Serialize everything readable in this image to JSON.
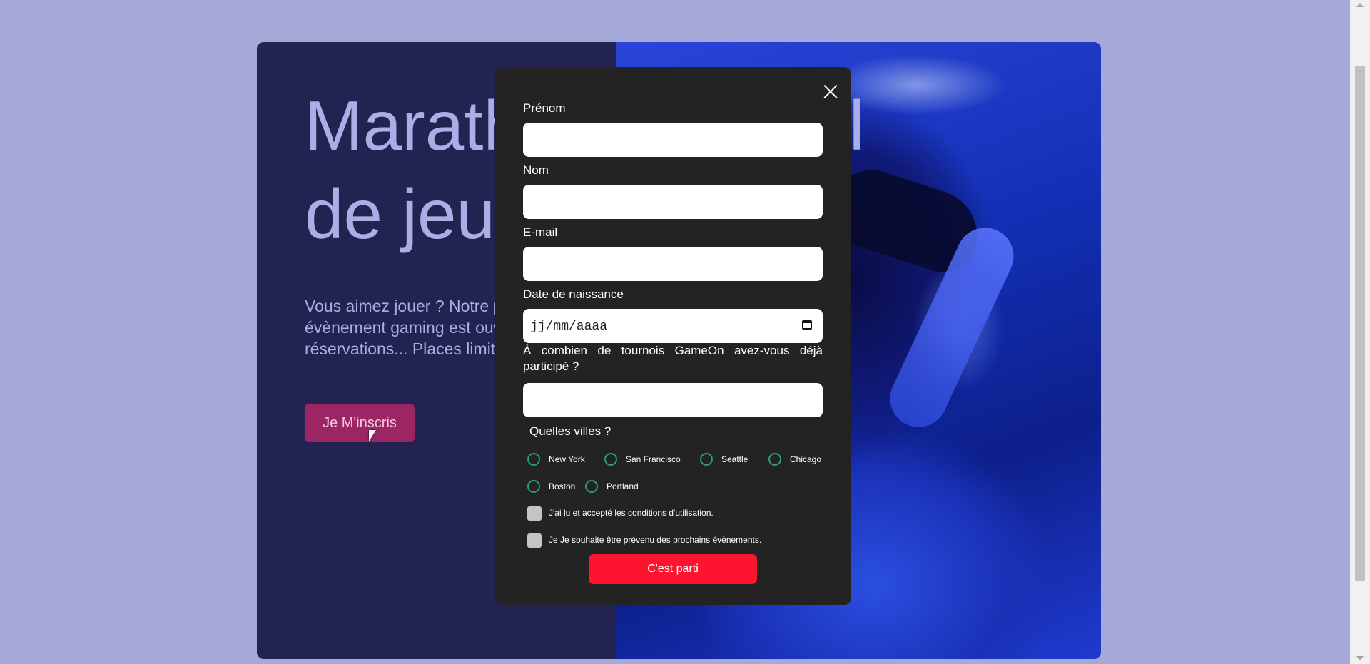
{
  "hero": {
    "title_line1": "Marathon national",
    "title_line2": "de jeux vidéos",
    "text": "Vous aimez jouer ? Notre prochain évènement gaming est ouvert aux réservations... Places limitées !",
    "signup_button": "Je M'inscris"
  },
  "modal": {
    "fields": {
      "first": {
        "label": "Prénom",
        "value": ""
      },
      "last": {
        "label": "Nom",
        "value": ""
      },
      "email": {
        "label": "E-mail",
        "value": ""
      },
      "birthdate": {
        "label": "Date de naissance",
        "placeholder": "jj/mm/aaaa"
      },
      "quantity": {
        "label": "À combien de tournois GameOn avez-vous déjà participé ?",
        "value": ""
      }
    },
    "cities_label": "Quelles villes ?",
    "cities": [
      "New York",
      "San Francisco",
      "Seattle",
      "Chicago",
      "Boston",
      "Portland"
    ],
    "checkbox_terms": "J'ai lu et accepté les conditions d'utilisation.",
    "checkbox_newsletter": "Je Je souhaite être prévenu des prochains évènements.",
    "submit": "C'est parti"
  },
  "colors": {
    "background": "#a5a9d8",
    "hero_dark": "#232351",
    "accent_button": "#9b2663",
    "submit_red": "#fe142f",
    "radio_green": "#279e7a",
    "modal_bg": "#232323"
  },
  "icons": [
    "close-icon",
    "calendar-icon",
    "mouse-cursor-icon"
  ]
}
